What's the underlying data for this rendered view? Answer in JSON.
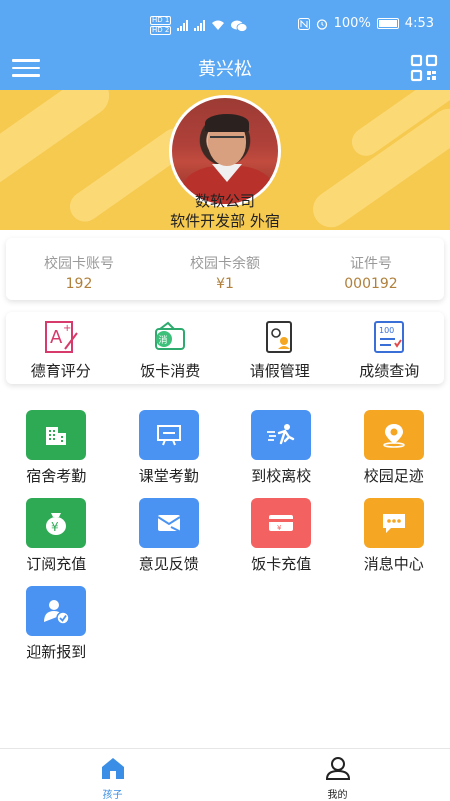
{
  "status_bar": {
    "battery": "100%",
    "time": "4:53",
    "hd1": "HD 1",
    "hd2": "HD 2",
    "net": "4G"
  },
  "header": {
    "title": "黄兴松",
    "menu_icon": "menu-icon",
    "qr_icon": "qr-scan-icon"
  },
  "profile": {
    "company": "数软公司",
    "dept": "软件开发部   外宿"
  },
  "card_info": [
    {
      "label": "校园卡账号",
      "value": "192"
    },
    {
      "label": "校园卡余额",
      "value": "¥1"
    },
    {
      "label": "证件号",
      "value": "000192"
    }
  ],
  "top_menu": [
    {
      "label": "德育评分",
      "icon": "moral-score-icon"
    },
    {
      "label": "饭卡消费",
      "icon": "meal-card-spend-icon"
    },
    {
      "label": "请假管理",
      "icon": "leave-manage-icon"
    },
    {
      "label": "成绩查询",
      "icon": "grade-query-icon"
    }
  ],
  "grid": [
    {
      "label": "宿舍考勤",
      "icon": "dorm-attendance-icon",
      "color": "#2eaa55"
    },
    {
      "label": "课堂考勤",
      "icon": "class-attendance-icon",
      "color": "#4a93f3"
    },
    {
      "label": "到校离校",
      "icon": "arrive-leave-icon",
      "color": "#4a93f3"
    },
    {
      "label": "校园足迹",
      "icon": "campus-footprint-icon",
      "color": "#f5a623"
    },
    {
      "label": "订阅充值",
      "icon": "subscribe-recharge-icon",
      "color": "#2eaa55"
    },
    {
      "label": "意见反馈",
      "icon": "feedback-icon",
      "color": "#4a93f3"
    },
    {
      "label": "饭卡充值",
      "icon": "meal-card-recharge-icon",
      "color": "#f36161"
    },
    {
      "label": "消息中心",
      "icon": "message-center-icon",
      "color": "#f5a623"
    },
    {
      "label": "迎新报到",
      "icon": "new-student-checkin-icon",
      "color": "#4a93f3"
    }
  ],
  "tabs": [
    {
      "label": "孩子",
      "icon": "home-icon",
      "active": true,
      "color": "#3a8ee6"
    },
    {
      "label": "我的",
      "icon": "user-icon",
      "active": false,
      "color": "#222222"
    }
  ]
}
